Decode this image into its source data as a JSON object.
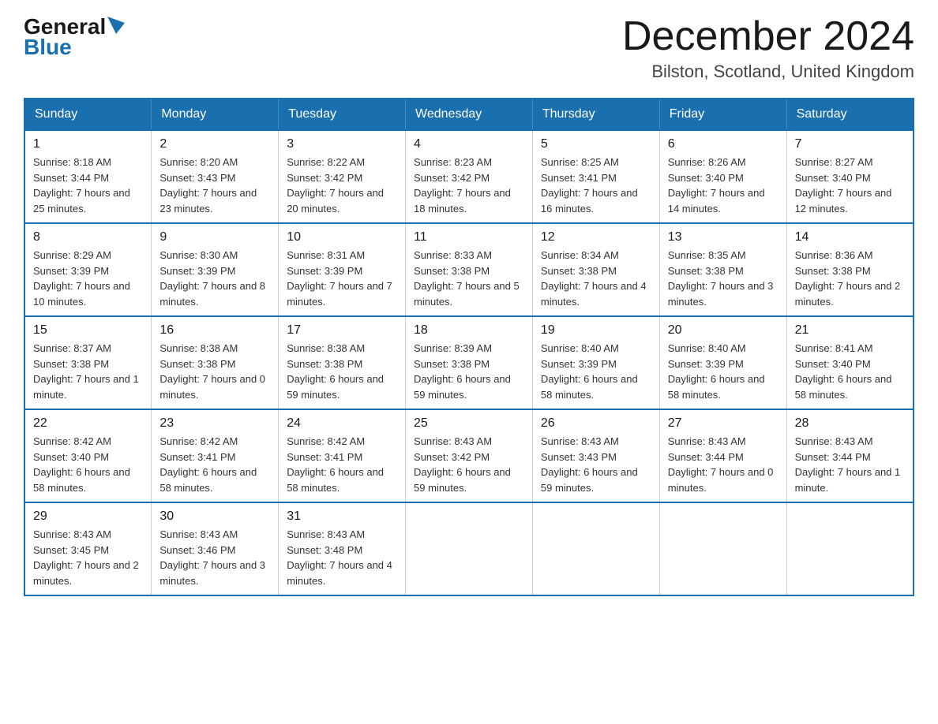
{
  "logo": {
    "general": "General",
    "blue": "Blue"
  },
  "title": "December 2024",
  "location": "Bilston, Scotland, United Kingdom",
  "days_of_week": [
    "Sunday",
    "Monday",
    "Tuesday",
    "Wednesday",
    "Thursday",
    "Friday",
    "Saturday"
  ],
  "weeks": [
    [
      {
        "day": "1",
        "sunrise": "8:18 AM",
        "sunset": "3:44 PM",
        "daylight": "7 hours and 25 minutes."
      },
      {
        "day": "2",
        "sunrise": "8:20 AM",
        "sunset": "3:43 PM",
        "daylight": "7 hours and 23 minutes."
      },
      {
        "day": "3",
        "sunrise": "8:22 AM",
        "sunset": "3:42 PM",
        "daylight": "7 hours and 20 minutes."
      },
      {
        "day": "4",
        "sunrise": "8:23 AM",
        "sunset": "3:42 PM",
        "daylight": "7 hours and 18 minutes."
      },
      {
        "day": "5",
        "sunrise": "8:25 AM",
        "sunset": "3:41 PM",
        "daylight": "7 hours and 16 minutes."
      },
      {
        "day": "6",
        "sunrise": "8:26 AM",
        "sunset": "3:40 PM",
        "daylight": "7 hours and 14 minutes."
      },
      {
        "day": "7",
        "sunrise": "8:27 AM",
        "sunset": "3:40 PM",
        "daylight": "7 hours and 12 minutes."
      }
    ],
    [
      {
        "day": "8",
        "sunrise": "8:29 AM",
        "sunset": "3:39 PM",
        "daylight": "7 hours and 10 minutes."
      },
      {
        "day": "9",
        "sunrise": "8:30 AM",
        "sunset": "3:39 PM",
        "daylight": "7 hours and 8 minutes."
      },
      {
        "day": "10",
        "sunrise": "8:31 AM",
        "sunset": "3:39 PM",
        "daylight": "7 hours and 7 minutes."
      },
      {
        "day": "11",
        "sunrise": "8:33 AM",
        "sunset": "3:38 PM",
        "daylight": "7 hours and 5 minutes."
      },
      {
        "day": "12",
        "sunrise": "8:34 AM",
        "sunset": "3:38 PM",
        "daylight": "7 hours and 4 minutes."
      },
      {
        "day": "13",
        "sunrise": "8:35 AM",
        "sunset": "3:38 PM",
        "daylight": "7 hours and 3 minutes."
      },
      {
        "day": "14",
        "sunrise": "8:36 AM",
        "sunset": "3:38 PM",
        "daylight": "7 hours and 2 minutes."
      }
    ],
    [
      {
        "day": "15",
        "sunrise": "8:37 AM",
        "sunset": "3:38 PM",
        "daylight": "7 hours and 1 minute."
      },
      {
        "day": "16",
        "sunrise": "8:38 AM",
        "sunset": "3:38 PM",
        "daylight": "7 hours and 0 minutes."
      },
      {
        "day": "17",
        "sunrise": "8:38 AM",
        "sunset": "3:38 PM",
        "daylight": "6 hours and 59 minutes."
      },
      {
        "day": "18",
        "sunrise": "8:39 AM",
        "sunset": "3:38 PM",
        "daylight": "6 hours and 59 minutes."
      },
      {
        "day": "19",
        "sunrise": "8:40 AM",
        "sunset": "3:39 PM",
        "daylight": "6 hours and 58 minutes."
      },
      {
        "day": "20",
        "sunrise": "8:40 AM",
        "sunset": "3:39 PM",
        "daylight": "6 hours and 58 minutes."
      },
      {
        "day": "21",
        "sunrise": "8:41 AM",
        "sunset": "3:40 PM",
        "daylight": "6 hours and 58 minutes."
      }
    ],
    [
      {
        "day": "22",
        "sunrise": "8:42 AM",
        "sunset": "3:40 PM",
        "daylight": "6 hours and 58 minutes."
      },
      {
        "day": "23",
        "sunrise": "8:42 AM",
        "sunset": "3:41 PM",
        "daylight": "6 hours and 58 minutes."
      },
      {
        "day": "24",
        "sunrise": "8:42 AM",
        "sunset": "3:41 PM",
        "daylight": "6 hours and 58 minutes."
      },
      {
        "day": "25",
        "sunrise": "8:43 AM",
        "sunset": "3:42 PM",
        "daylight": "6 hours and 59 minutes."
      },
      {
        "day": "26",
        "sunrise": "8:43 AM",
        "sunset": "3:43 PM",
        "daylight": "6 hours and 59 minutes."
      },
      {
        "day": "27",
        "sunrise": "8:43 AM",
        "sunset": "3:44 PM",
        "daylight": "7 hours and 0 minutes."
      },
      {
        "day": "28",
        "sunrise": "8:43 AM",
        "sunset": "3:44 PM",
        "daylight": "7 hours and 1 minute."
      }
    ],
    [
      {
        "day": "29",
        "sunrise": "8:43 AM",
        "sunset": "3:45 PM",
        "daylight": "7 hours and 2 minutes."
      },
      {
        "day": "30",
        "sunrise": "8:43 AM",
        "sunset": "3:46 PM",
        "daylight": "7 hours and 3 minutes."
      },
      {
        "day": "31",
        "sunrise": "8:43 AM",
        "sunset": "3:48 PM",
        "daylight": "7 hours and 4 minutes."
      },
      null,
      null,
      null,
      null
    ]
  ]
}
